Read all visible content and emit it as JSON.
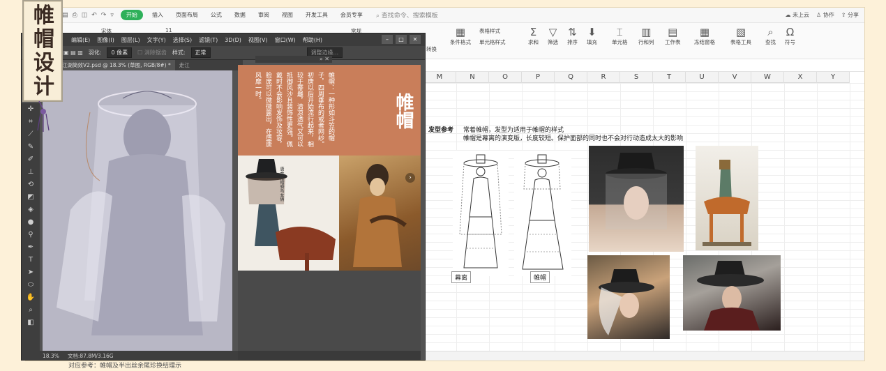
{
  "banner": {
    "title": "帷帽设计"
  },
  "spreadsheet": {
    "menubar": {
      "items": [
        "开始",
        "插入",
        "页面布局",
        "公式",
        "数据",
        "审阅",
        "视图",
        "开发工具",
        "会员专享"
      ],
      "search_placeholder": "查找命令、搜索模板",
      "right": {
        "cloud": "未上云",
        "collab": "协作",
        "share": "分享"
      }
    },
    "ribbon": {
      "font_name": "宋体",
      "font_size": "11",
      "number_format": "常规",
      "convert": "转换",
      "cond_format": "条件格式",
      "table_style": "表格样式",
      "cell_style": "单元格样式",
      "sum": "求和",
      "filter": "筛选",
      "sort": "排序",
      "fill": "填充",
      "cell": "单元格",
      "row_col": "行和列",
      "worksheet": "工作表",
      "freeze": "冻结窗格",
      "table_tools": "表格工具",
      "find": "查找",
      "symbol": "符号"
    },
    "columns": [
      "M",
      "N",
      "O",
      "P",
      "Q",
      "R",
      "S",
      "T",
      "U",
      "V",
      "W",
      "X",
      "Y"
    ],
    "content": {
      "ref_label": "发型参考",
      "ref_line1": "常着帷帽，发型为适用于帷帽的样式",
      "ref_line2": "帷帽是幕离的演变版，长度较短。保护面部的同时也不会对行动造成太大的影响",
      "caption_left": "幕离",
      "caption_right": "帷帽"
    }
  },
  "photoshop": {
    "menus": [
      "编辑(E)",
      "图像(I)",
      "图层(L)",
      "文字(Y)",
      "选择(S)",
      "滤镜(T)",
      "3D(D)",
      "视图(V)",
      "窗口(W)",
      "帮助(H)"
    ],
    "options": {
      "feather_label": "羽化:",
      "feather_value": "0 像素",
      "antialias": "消除锯齿",
      "style_label": "样式:",
      "style_value": "正常",
      "refine": "调整边缘..."
    },
    "tabs": [
      "视图】走江湖简效V2.psd @ 18.3% (草图, RGB/8#) *",
      "走江"
    ],
    "status": {
      "zoom": "18.3%",
      "doc": "文档:87.8M/3.16G"
    },
    "article": {
      "title": "帷帽",
      "body": "帷帽：一种形如斗笠的帽子，四周垂布的或者网纱。初唐以后开始流行起来，相较于幂䍦，清凉透气又可以抵御风沙且装饰性更强。佩戴时不会影响发饰及妆容，脸庞可以微微露出，在盛唐风靡一时。",
      "caption": "唐·戴帷帽骑马女俑"
    }
  },
  "footer": {
    "text": "对应参考：帷帽及半出丝余尾珍换结理示"
  }
}
